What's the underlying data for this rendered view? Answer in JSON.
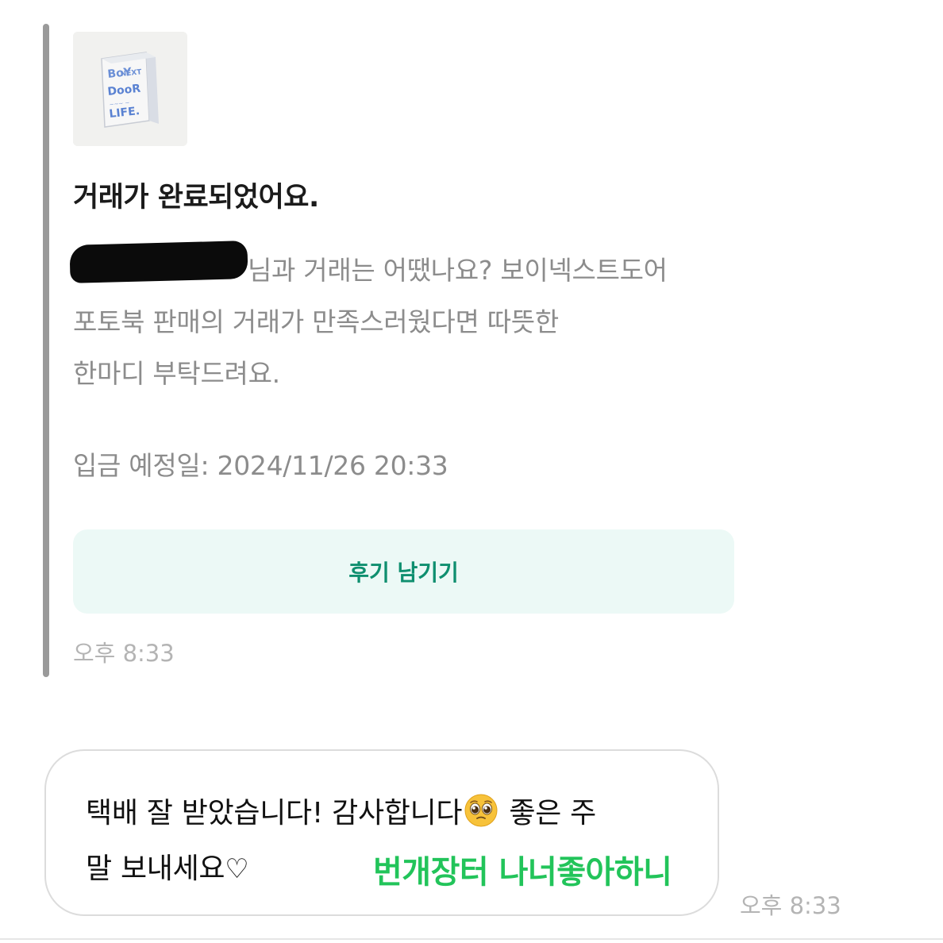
{
  "system_message": {
    "title": "거래가 완료되었어요.",
    "body_lines": [
      "님과 거래는 어땠나요? 보이넥스트도어",
      "포토북 판매의 거래가 만족스러웠다면 따뜻한",
      "한마디 부탁드려요."
    ],
    "deposit_text": "입금 예정일: 2024/11/26 20:33",
    "review_button_label": "후기 남기기",
    "time": "오후 8:33",
    "thumbnail_label": "BOY NEXT DOOR LIFE"
  },
  "user_message": {
    "lines": [
      "택배 잘 받았습니다! 감사합니다",
      "좋은 주",
      "말 보내세요"
    ],
    "emoji": "pleading-face-icon",
    "heart": "♡",
    "time": "오후 8:33"
  },
  "overlay_caption": "번개장터 나너좋아하니",
  "colors": {
    "accent_green": "#0f8f6f",
    "button_bg": "#ecf9f6",
    "caption_green": "#22c45a",
    "muted_text": "#8c8c8c"
  }
}
